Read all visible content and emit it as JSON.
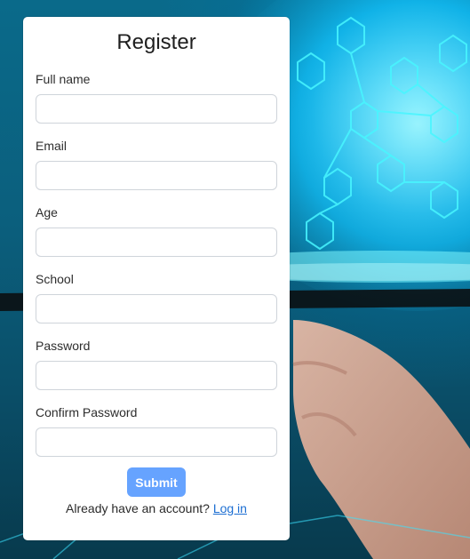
{
  "register_card": {
    "title": "Register",
    "fields": [
      {
        "label": "Full name",
        "value": "",
        "placeholder": ""
      },
      {
        "label": "Email",
        "value": "",
        "placeholder": ""
      },
      {
        "label": "Age",
        "value": "",
        "placeholder": ""
      },
      {
        "label": "School",
        "value": "",
        "placeholder": ""
      },
      {
        "label": "Password",
        "value": "",
        "placeholder": ""
      },
      {
        "label": "Confirm Password",
        "value": "",
        "placeholder": ""
      }
    ],
    "submit_label": "Submit",
    "login_prompt": "Already have an account?",
    "login_link": "Log in"
  },
  "colors": {
    "submit_button": "#66a3ff",
    "link": "#1c6ed2"
  }
}
